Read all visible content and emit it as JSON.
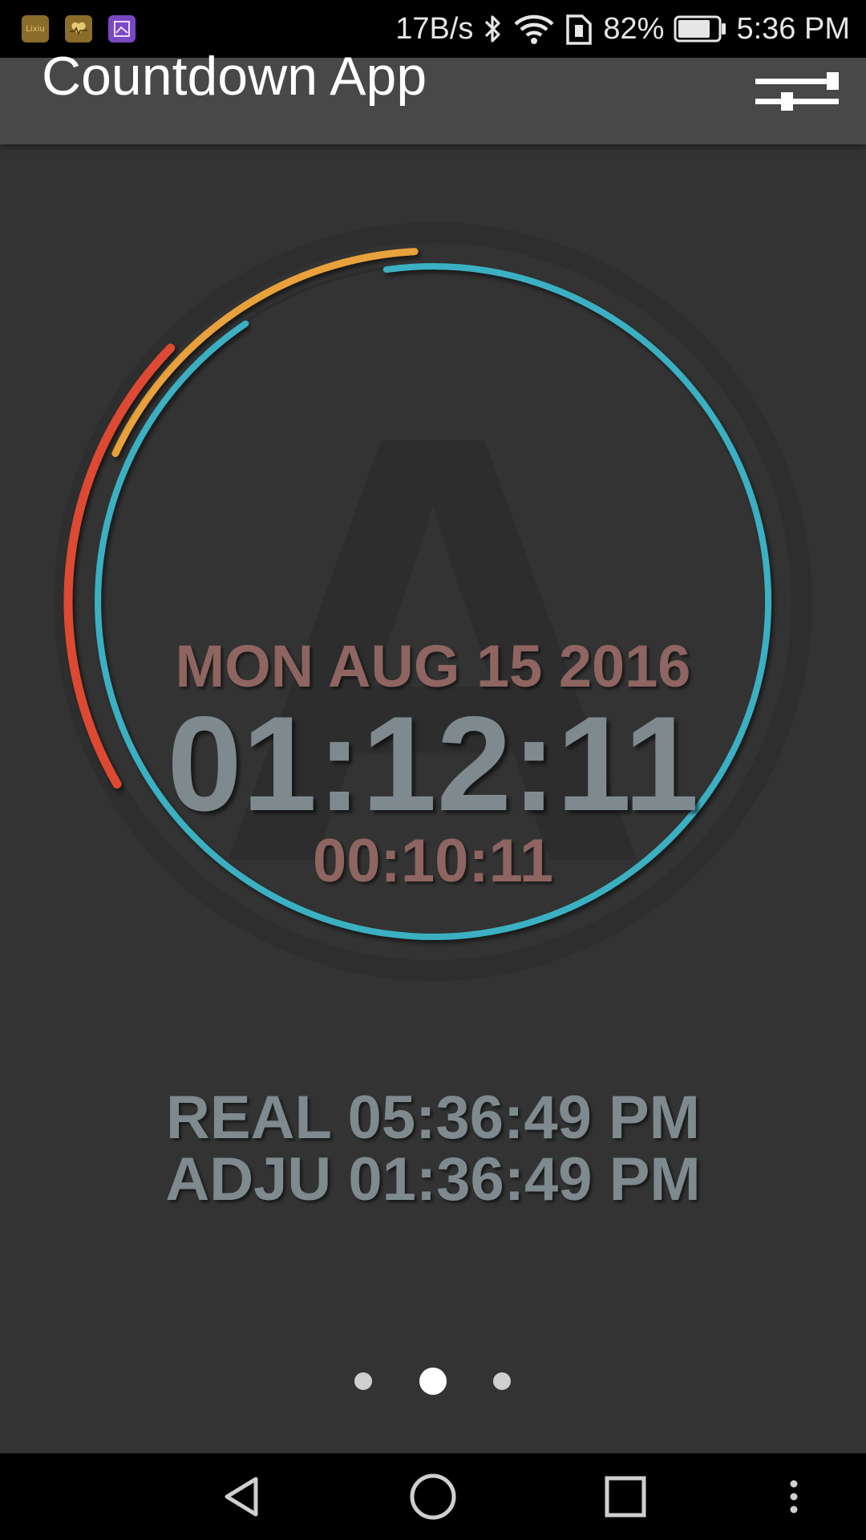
{
  "status_bar": {
    "notification_icons": [
      "lixiu-app-icon",
      "health-app-icon",
      "gallery-app-icon"
    ],
    "notification_icon_colors": [
      "#8a6d2a",
      "#8a6d2a",
      "#7b48c4"
    ],
    "network_speed": "17B/s",
    "battery_percent": "82%",
    "battery_level": 0.82,
    "time": "5:36 PM"
  },
  "app_bar": {
    "title": "Countdown App",
    "settings_icon": "sliders-icon"
  },
  "dial": {
    "date": "MON AUG 15 2016",
    "main_time": "01:12:11",
    "sub_time": "00:10:11",
    "watermark": "A",
    "colors": {
      "teal": "#3ab0c2",
      "orange": "#e8a13a",
      "red": "#dd4a33",
      "track": "#2b2b2b"
    }
  },
  "clocks": {
    "real": "REAL 05:36:49 PM",
    "adjusted": "ADJU 01:36:49 PM"
  },
  "pager": {
    "page_count": 3,
    "active_page": 2
  },
  "nav_bar": {
    "icons": [
      "back-icon",
      "home-icon",
      "recents-icon",
      "more-icon"
    ]
  }
}
